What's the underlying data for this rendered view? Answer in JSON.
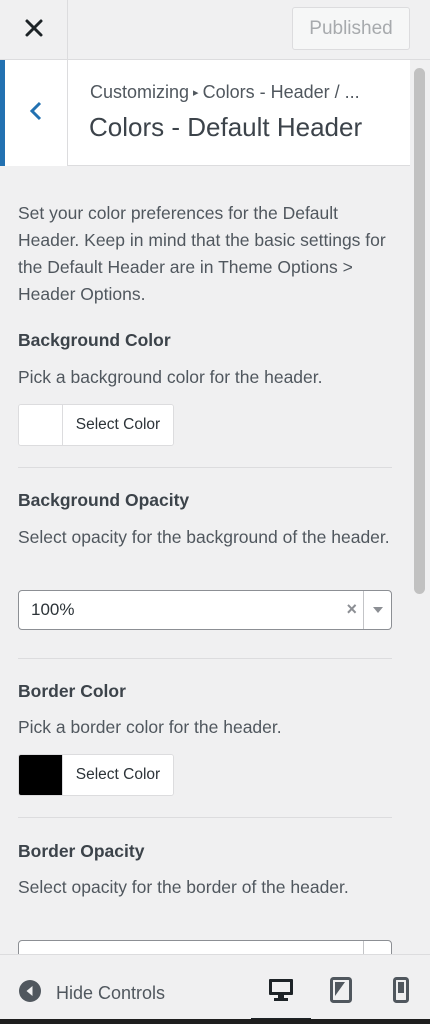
{
  "topbar": {
    "close_icon": "close-icon",
    "publish_label": "Published"
  },
  "section": {
    "breadcrumb_root": "Customizing",
    "breadcrumb_child": "Colors - Header / ...",
    "title": "Colors - Default Header",
    "back_icon": "chevron-left-icon"
  },
  "description": "Set your color preferences for the Default Header. Keep in mind that the basic settings for the Default Header are in Theme Options > Header Options.",
  "controls": {
    "bg_color": {
      "title": "Background Color",
      "desc": "Pick a background color for the header.",
      "button_label": "Select Color",
      "swatch": "#ffffff"
    },
    "bg_opacity": {
      "title": "Background Opacity",
      "desc": "Select opacity for the background of the header.",
      "value": "100%",
      "clear": "×"
    },
    "border_color": {
      "title": "Border Color",
      "desc": "Pick a border color for the header.",
      "button_label": "Select Color",
      "swatch": "#000000"
    },
    "border_opacity": {
      "title": "Border Opacity",
      "desc": "Select opacity for the border of the header."
    }
  },
  "footer": {
    "hide_label": "Hide Controls",
    "devices": [
      "desktop-icon",
      "tablet-icon",
      "mobile-icon"
    ],
    "active_device": "desktop"
  },
  "colors": {
    "accent": "#2271b1",
    "panel_bg": "#f0f0f1"
  }
}
